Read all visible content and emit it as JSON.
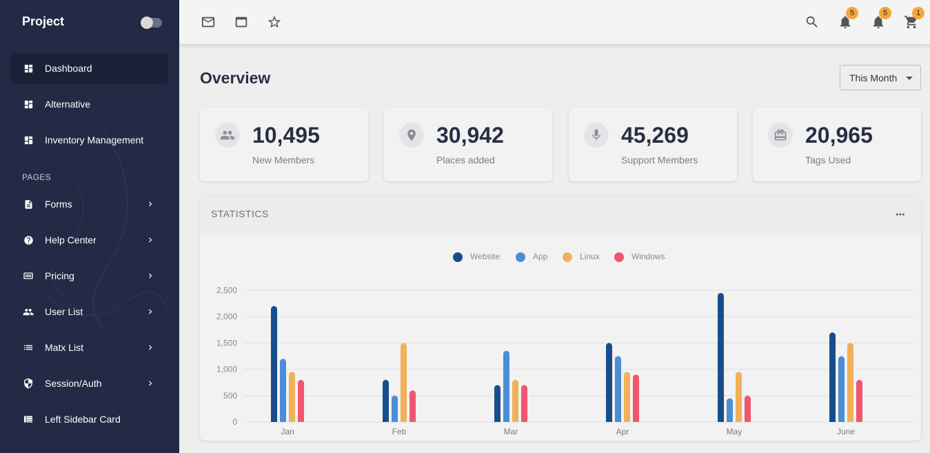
{
  "sidebar": {
    "brand": "Project",
    "items": [
      {
        "label": "Dashboard",
        "icon": "dashboard-icon",
        "active": true,
        "chevron": false
      },
      {
        "label": "Alternative",
        "icon": "dashboard-icon",
        "active": false,
        "chevron": false
      },
      {
        "label": "Inventory Management",
        "icon": "dashboard-icon",
        "active": false,
        "chevron": false
      }
    ],
    "section_label": "PAGES",
    "pages": [
      {
        "label": "Forms",
        "icon": "description-icon",
        "chevron": true
      },
      {
        "label": "Help Center",
        "icon": "help-icon",
        "chevron": true
      },
      {
        "label": "Pricing",
        "icon": "pricing-icon",
        "chevron": true
      },
      {
        "label": "User List",
        "icon": "people-icon",
        "chevron": true
      },
      {
        "label": "Matx List",
        "icon": "list-icon",
        "chevron": true
      },
      {
        "label": "Session/Auth",
        "icon": "security-icon",
        "chevron": true
      },
      {
        "label": "Left Sidebar Card",
        "icon": "sidebar-card-icon",
        "chevron": false
      }
    ]
  },
  "topbar": {
    "left_icons": [
      "mail-icon",
      "window-icon",
      "star-icon"
    ],
    "right_icons": [
      {
        "icon": "search-icon",
        "badge": null
      },
      {
        "icon": "notification-icon",
        "badge": "5"
      },
      {
        "icon": "notification-icon",
        "badge": "5"
      },
      {
        "icon": "cart-icon",
        "badge": "1"
      }
    ]
  },
  "overview": {
    "title": "Overview",
    "period_select": "This Month"
  },
  "stats": [
    {
      "value": "10,495",
      "label": "New Members",
      "icon": "people-icon"
    },
    {
      "value": "30,942",
      "label": "Places added",
      "icon": "location-icon"
    },
    {
      "value": "45,269",
      "label": "Support Members",
      "icon": "mic-icon"
    },
    {
      "value": "20,965",
      "label": "Tags Used",
      "icon": "card-giftcard-icon"
    }
  ],
  "statistics": {
    "title": "STATISTICS",
    "more_icon": "more-horiz-icon"
  },
  "colors": {
    "sidebar_bg": "#222a45",
    "website": "#184d8c",
    "app": "#4a8ed6",
    "linux": "#f0b159",
    "windows": "#f0566e",
    "badge": "#f4a83a"
  },
  "chart_data": {
    "type": "bar",
    "categories": [
      "Jan",
      "Feb",
      "Mar",
      "Apr",
      "May",
      "June"
    ],
    "series": [
      {
        "name": "Website",
        "color": "#184d8c",
        "values": [
          2200,
          800,
          700,
          1500,
          2450,
          1700
        ]
      },
      {
        "name": "App",
        "color": "#4a8ed6",
        "values": [
          1200,
          500,
          1350,
          1250,
          450,
          1250
        ]
      },
      {
        "name": "Linux",
        "color": "#f0b159",
        "values": [
          950,
          1500,
          800,
          950,
          950,
          1500
        ]
      },
      {
        "name": "Windows",
        "color": "#f0566e",
        "values": [
          800,
          600,
          700,
          900,
          500,
          800
        ]
      }
    ],
    "ylim": [
      0,
      2500
    ],
    "yticks": [
      0,
      500,
      1000,
      1500,
      2000,
      2500
    ],
    "ytick_labels": [
      "0",
      "500",
      "1,000",
      "1,500",
      "2,000",
      "2,500"
    ],
    "legend_position": "top-center",
    "grid": true
  }
}
